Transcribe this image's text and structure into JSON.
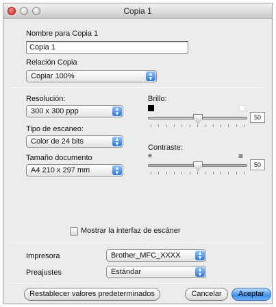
{
  "window": {
    "title": "Copia 1"
  },
  "name_section": {
    "label": "Nombre para Copia 1",
    "value": "Copia 1"
  },
  "relation": {
    "label": "Relación Copia",
    "selected": "Copiar 100%"
  },
  "resolution": {
    "label": "Resolución:",
    "selected": "300 x 300 ppp"
  },
  "scan_type": {
    "label": "Tipo de escaneo:",
    "selected": "Color de 24 bits"
  },
  "document_size": {
    "label": "Tamaño documento",
    "selected": "A4  210 x 297 mm"
  },
  "brightness": {
    "label": "Brillo:",
    "value": "50",
    "level": 0.5
  },
  "contrast": {
    "label": "Contraste:",
    "value": "50",
    "level": 0.5
  },
  "scanner_interface": {
    "label": "Mostrar la interfaz de escáner",
    "checked": false
  },
  "printer": {
    "label": "Impresora",
    "selected": "Brother_MFC_XXXX"
  },
  "presets": {
    "label": "Preajustes",
    "selected": "Estándar"
  },
  "buttons": {
    "restore": "Restablecer valores predeterminados",
    "cancel": "Cancelar",
    "accept": "Aceptar"
  },
  "colors": {
    "accent": "#3f8fe9",
    "close": "#d3271c"
  }
}
